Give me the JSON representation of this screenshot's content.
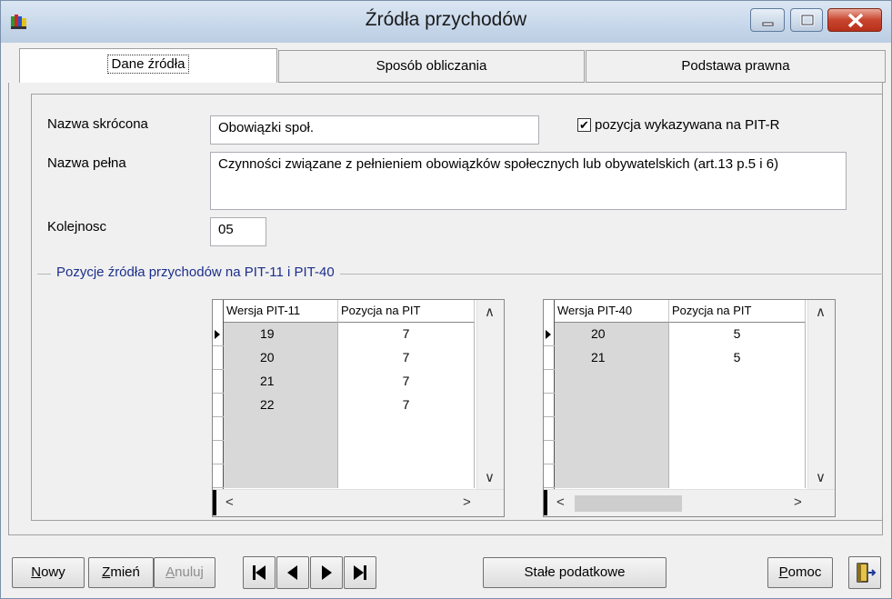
{
  "window": {
    "title": "Źródła przychodów"
  },
  "tabs": [
    {
      "label": "Dane źródła",
      "active": true
    },
    {
      "label": "Sposób obliczania",
      "active": false
    },
    {
      "label": "Podstawa prawna",
      "active": false
    }
  ],
  "form": {
    "short_name_label": "Nazwa skrócona",
    "short_name_value": "Obowiązki społ.",
    "full_name_label": "Nazwa pełna",
    "full_name_value": "Czynności związane z pełnieniem obowiązków społecznych lub obywatelskich (art.13 p.5 i 6)",
    "order_label": "Kolejnosc",
    "order_value": "05",
    "pit_r_checkbox_label": "pozycja wykazywana na PIT-R",
    "pit_r_checked": true
  },
  "group": {
    "title": "Pozycje źródła przychodów na PIT-11 i PIT-40"
  },
  "grid_pit11": {
    "columns": [
      "Wersja PIT-11",
      "Pozycja na PIT"
    ],
    "rows": [
      [
        "19",
        "7"
      ],
      [
        "20",
        "7"
      ],
      [
        "21",
        "7"
      ],
      [
        "22",
        "7"
      ]
    ]
  },
  "grid_pit40": {
    "columns": [
      "Wersja PIT-40",
      "Pozycja na PIT"
    ],
    "rows": [
      [
        "20",
        "5"
      ],
      [
        "21",
        "5"
      ]
    ]
  },
  "buttons": {
    "new": {
      "label_u": "N",
      "label_rest": "owy"
    },
    "edit": {
      "label_u": "Z",
      "label_rest": "mień"
    },
    "cancel": {
      "label_u": "A",
      "label_rest": "nuluj"
    },
    "tax_constants": "Stałe podatkowe",
    "help": {
      "label_u": "P",
      "label_rest": "omoc"
    }
  },
  "colors": {
    "group_title": "#1c2f8c",
    "close_button": "#c9452f",
    "titlebar": "#c7d7ea"
  }
}
